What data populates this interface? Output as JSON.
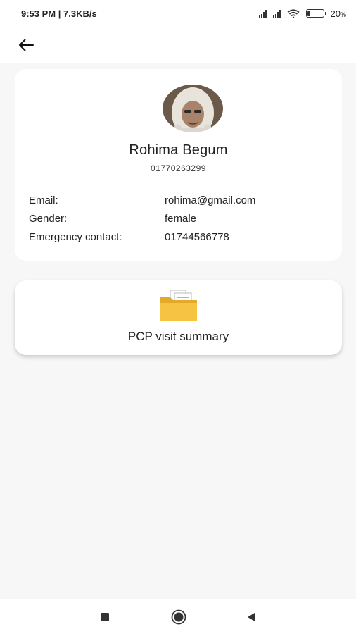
{
  "status_bar": {
    "time_speed": "9:53 PM | 7.3KB/s",
    "battery": "20",
    "battery_level": 0.2
  },
  "profile": {
    "name": "Rohima Begum",
    "phone": "01770263299",
    "fields": [
      {
        "label": "Email:",
        "value": "rohima@gmail.com"
      },
      {
        "label": "Gender:",
        "value": "female"
      },
      {
        "label": "Emergency contact:",
        "value": "01744566778"
      }
    ]
  },
  "pcp": {
    "label": "PCP visit summary",
    "icon": "folder-icon"
  },
  "colors": {
    "background": "#f7f7f7",
    "card": "#ffffff",
    "folder": "#f6c342"
  }
}
